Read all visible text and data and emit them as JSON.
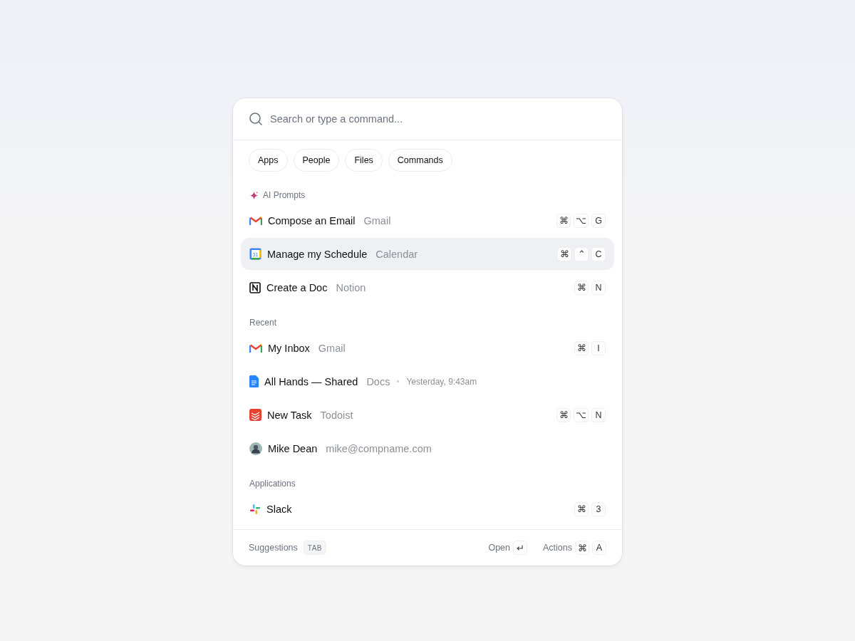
{
  "search": {
    "placeholder": "Search or type a command..."
  },
  "filters": [
    {
      "label": "Apps",
      "selected": false
    },
    {
      "label": "People",
      "selected": false
    },
    {
      "label": "Files",
      "selected": false
    },
    {
      "label": "Commands",
      "selected": false
    }
  ],
  "sections": [
    {
      "title": "AI Prompts",
      "kind": "ai",
      "items": [
        {
          "kind": "gmail",
          "title": "Compose an Email",
          "source": "Gmail",
          "selected": false,
          "keys": [
            "⌘",
            "⌥",
            "G"
          ]
        },
        {
          "kind": "calendar",
          "icon_text": "31",
          "title": "Manage my Schedule",
          "source": "Calendar",
          "selected": true,
          "keys": [
            "⌘",
            "⌃",
            "C"
          ]
        },
        {
          "kind": "notion",
          "title": "Create a Doc",
          "source": "Notion",
          "selected": false,
          "keys": [
            "⌘",
            "N"
          ]
        }
      ]
    },
    {
      "title": "Recent",
      "kind": "plain",
      "items": [
        {
          "kind": "gmail",
          "title": "My Inbox",
          "source": "Gmail",
          "selected": false,
          "keys": [
            "⌘",
            "I"
          ]
        },
        {
          "kind": "docs",
          "title": "All Hands — Shared",
          "source": "Docs",
          "time": "Yesterday, 9:43am",
          "selected": false
        },
        {
          "kind": "todoist",
          "title": "New Task",
          "source": "Todoist",
          "selected": false,
          "keys": [
            "⌘",
            "⌥",
            "N"
          ]
        },
        {
          "kind": "person",
          "title": "Mike Dean",
          "source": "mike@compname.com",
          "selected": false
        }
      ]
    },
    {
      "title": "Applications",
      "kind": "plain",
      "items": [
        {
          "kind": "slack",
          "title": "Slack",
          "selected": false,
          "keys": [
            "⌘",
            "3"
          ]
        }
      ]
    }
  ],
  "footer": {
    "suggestions": "Suggestions",
    "suggestions_key": "TAB",
    "open": "Open",
    "open_key": "↵",
    "actions": "Actions",
    "actions_keys": [
      "⌘",
      "A"
    ]
  }
}
